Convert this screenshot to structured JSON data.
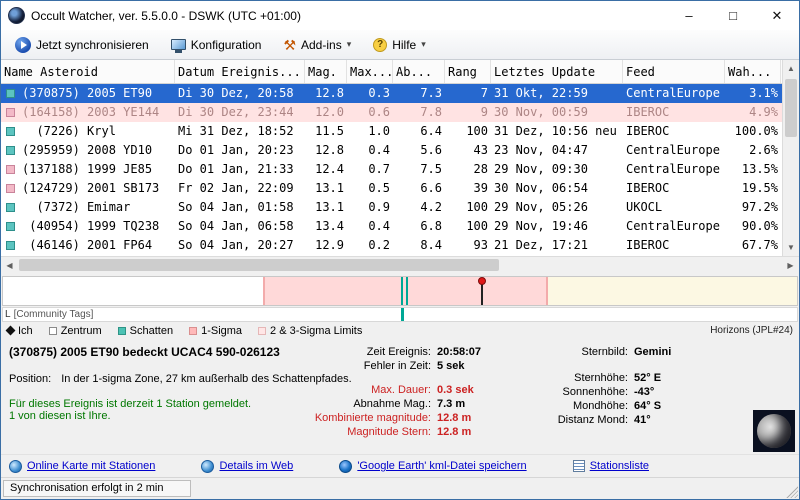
{
  "window": {
    "title": "Occult Watcher, ver. 5.5.0.0 - DSWK (UTC +01:00)",
    "controls": {
      "minimize": "–",
      "maximize": "□",
      "close": "✕"
    }
  },
  "toolbar": {
    "sync_label": "Jetzt synchronisieren",
    "config_label": "Konfiguration",
    "addins_label": "Add-ins",
    "help_label": "Hilfe"
  },
  "table": {
    "columns": [
      {
        "key": "name",
        "label": "Name Asteroid"
      },
      {
        "key": "datum",
        "label": "Datum Ereignis..."
      },
      {
        "key": "mag",
        "label": "Mag."
      },
      {
        "key": "max",
        "label": "Max..."
      },
      {
        "key": "ab",
        "label": "Ab..."
      },
      {
        "key": "rang",
        "label": "Rang"
      },
      {
        "key": "update",
        "label": "Letztes Update"
      },
      {
        "key": "feed",
        "label": "Feed"
      },
      {
        "key": "wahr",
        "label": "Wah..."
      }
    ],
    "rows": [
      {
        "icon": "teal",
        "state": "selected",
        "name": "(370875) 2005 ET90",
        "datum": "Di 30 Dez, 20:58",
        "mag": "12.8",
        "max": "0.3",
        "ab": "7.3",
        "rang": "7",
        "update": "31 Okt, 22:59",
        "feed": "CentralEurope",
        "wahr": "3.1%"
      },
      {
        "icon": "pink",
        "state": "dim",
        "name": "(164158) 2003 YE144",
        "datum": "Di 30 Dez, 23:44",
        "mag": "12.0",
        "max": "0.6",
        "ab": "7.8",
        "rang": "9",
        "update": "30 Nov, 00:59",
        "feed": "IBEROC",
        "wahr": "4.9%"
      },
      {
        "icon": "teal",
        "state": "",
        "name": "  (7226) Kryl",
        "datum": "Mi 31 Dez, 18:52",
        "mag": "11.5",
        "max": "1.0",
        "ab": "6.4",
        "rang": "100",
        "update": "31 Dez, 10:56 neu",
        "feed": "IBEROC",
        "wahr": "100.0%"
      },
      {
        "icon": "teal",
        "state": "",
        "name": "(295959) 2008 YD10",
        "datum": "Do 01 Jan, 20:23",
        "mag": "12.8",
        "max": "0.4",
        "ab": "5.6",
        "rang": "43",
        "update": "23 Nov, 04:47",
        "feed": "CentralEurope",
        "wahr": "2.6%"
      },
      {
        "icon": "pink",
        "state": "",
        "name": "(137188) 1999 JE85",
        "datum": "Do 01 Jan, 21:33",
        "mag": "12.4",
        "max": "0.7",
        "ab": "7.5",
        "rang": "28",
        "update": "29 Nov, 09:30",
        "feed": "CentralEurope",
        "wahr": "13.5%"
      },
      {
        "icon": "pink",
        "state": "",
        "name": "(124729) 2001 SB173",
        "datum": "Fr 02 Jan, 22:09",
        "mag": "13.1",
        "max": "0.5",
        "ab": "6.6",
        "rang": "39",
        "update": "30 Nov, 06:54",
        "feed": "IBEROC",
        "wahr": "19.5%"
      },
      {
        "icon": "teal",
        "state": "",
        "name": "  (7372) Emimar",
        "datum": "So 04 Jan, 01:58",
        "mag": "13.1",
        "max": "0.9",
        "ab": "4.2",
        "rang": "100",
        "update": "29 Nov, 05:26",
        "feed": "UKOCL",
        "wahr": "97.2%"
      },
      {
        "icon": "teal",
        "state": "",
        "name": " (40954) 1999 TQ238",
        "datum": "So 04 Jan, 06:58",
        "mag": "13.4",
        "max": "0.4",
        "ab": "6.8",
        "rang": "100",
        "update": "29 Nov, 19:46",
        "feed": "CentralEurope",
        "wahr": "90.0%"
      },
      {
        "icon": "teal",
        "state": "",
        "name": " (46146) 2001 FP64",
        "datum": "So 04 Jan, 20:27",
        "mag": "12.9",
        "max": "0.2",
        "ab": "8.4",
        "rang": "93",
        "update": "21 Dez, 17:21",
        "feed": "IBEROC",
        "wahr": "67.7%"
      }
    ]
  },
  "timeline": {
    "lane_label": "L",
    "tags_label": "[Community Tags]"
  },
  "legend": {
    "ich": "Ich",
    "zentrum": "Zentrum",
    "schatten": "Schatten",
    "sigma1": "1-Sigma",
    "sigma23": "2 & 3-Sigma Limits",
    "source": "Horizons (JPL#24)"
  },
  "details": {
    "title": "(370875) 2005 ET90 bedeckt UCAC4 590-026123",
    "position_label": "Position:",
    "position_text": "In der 1-sigma Zone, 27 km außerhalb des Schattenpfades.",
    "stations_line1": "Für dieses Ereignis ist derzeit 1 Station gemeldet.",
    "stations_line2": "1 von diesen ist Ihre.",
    "mid": [
      {
        "label": "Zeit Ereignis:",
        "value": "20:58:07",
        "red": false
      },
      {
        "label": "Fehler in Zeit:",
        "value": "5 sek",
        "red": false
      },
      {
        "label": "Max. Dauer:",
        "value": "0.3 sek",
        "red": true
      },
      {
        "label": "Abnahme Mag.:",
        "value": "7.3 m",
        "red": false
      },
      {
        "label": "Kombinierte magnitude:",
        "value": "12.8 m",
        "red": true
      },
      {
        "label": "Magnitude Stern:",
        "value": "12.8 m",
        "red": true
      }
    ],
    "right": [
      {
        "label": "Sternbild:",
        "value": "Gemini"
      },
      {
        "label": "Sternhöhe:",
        "value": "52° E"
      },
      {
        "label": "Sonnenhöhe:",
        "value": "-43°"
      },
      {
        "label": "Mondhöhe:",
        "value": "64° S"
      },
      {
        "label": "Distanz Mond:",
        "value": "41°"
      }
    ]
  },
  "links": [
    {
      "id": "online-map",
      "icon": "globe",
      "label": "Online Karte mit Stationen"
    },
    {
      "id": "web-details",
      "icon": "globe",
      "label": "Details im Web"
    },
    {
      "id": "google-earth-kml",
      "icon": "earth",
      "label": "'Google Earth' kml-Datei speichern"
    },
    {
      "id": "station-list",
      "icon": "list",
      "label": "Stationsliste"
    }
  ],
  "statusbar": {
    "text": "Synchronisation erfolgt in 2 min"
  },
  "colors": {
    "selection_blue": "#2668cf",
    "dim_row_pink": "#ffe3e3",
    "sigma_band_pink": "#ffd9d9",
    "shadow_teal": "#00a896",
    "alert_red": "#cc2222",
    "station_green": "#007700",
    "link_blue": "#0000cc"
  }
}
